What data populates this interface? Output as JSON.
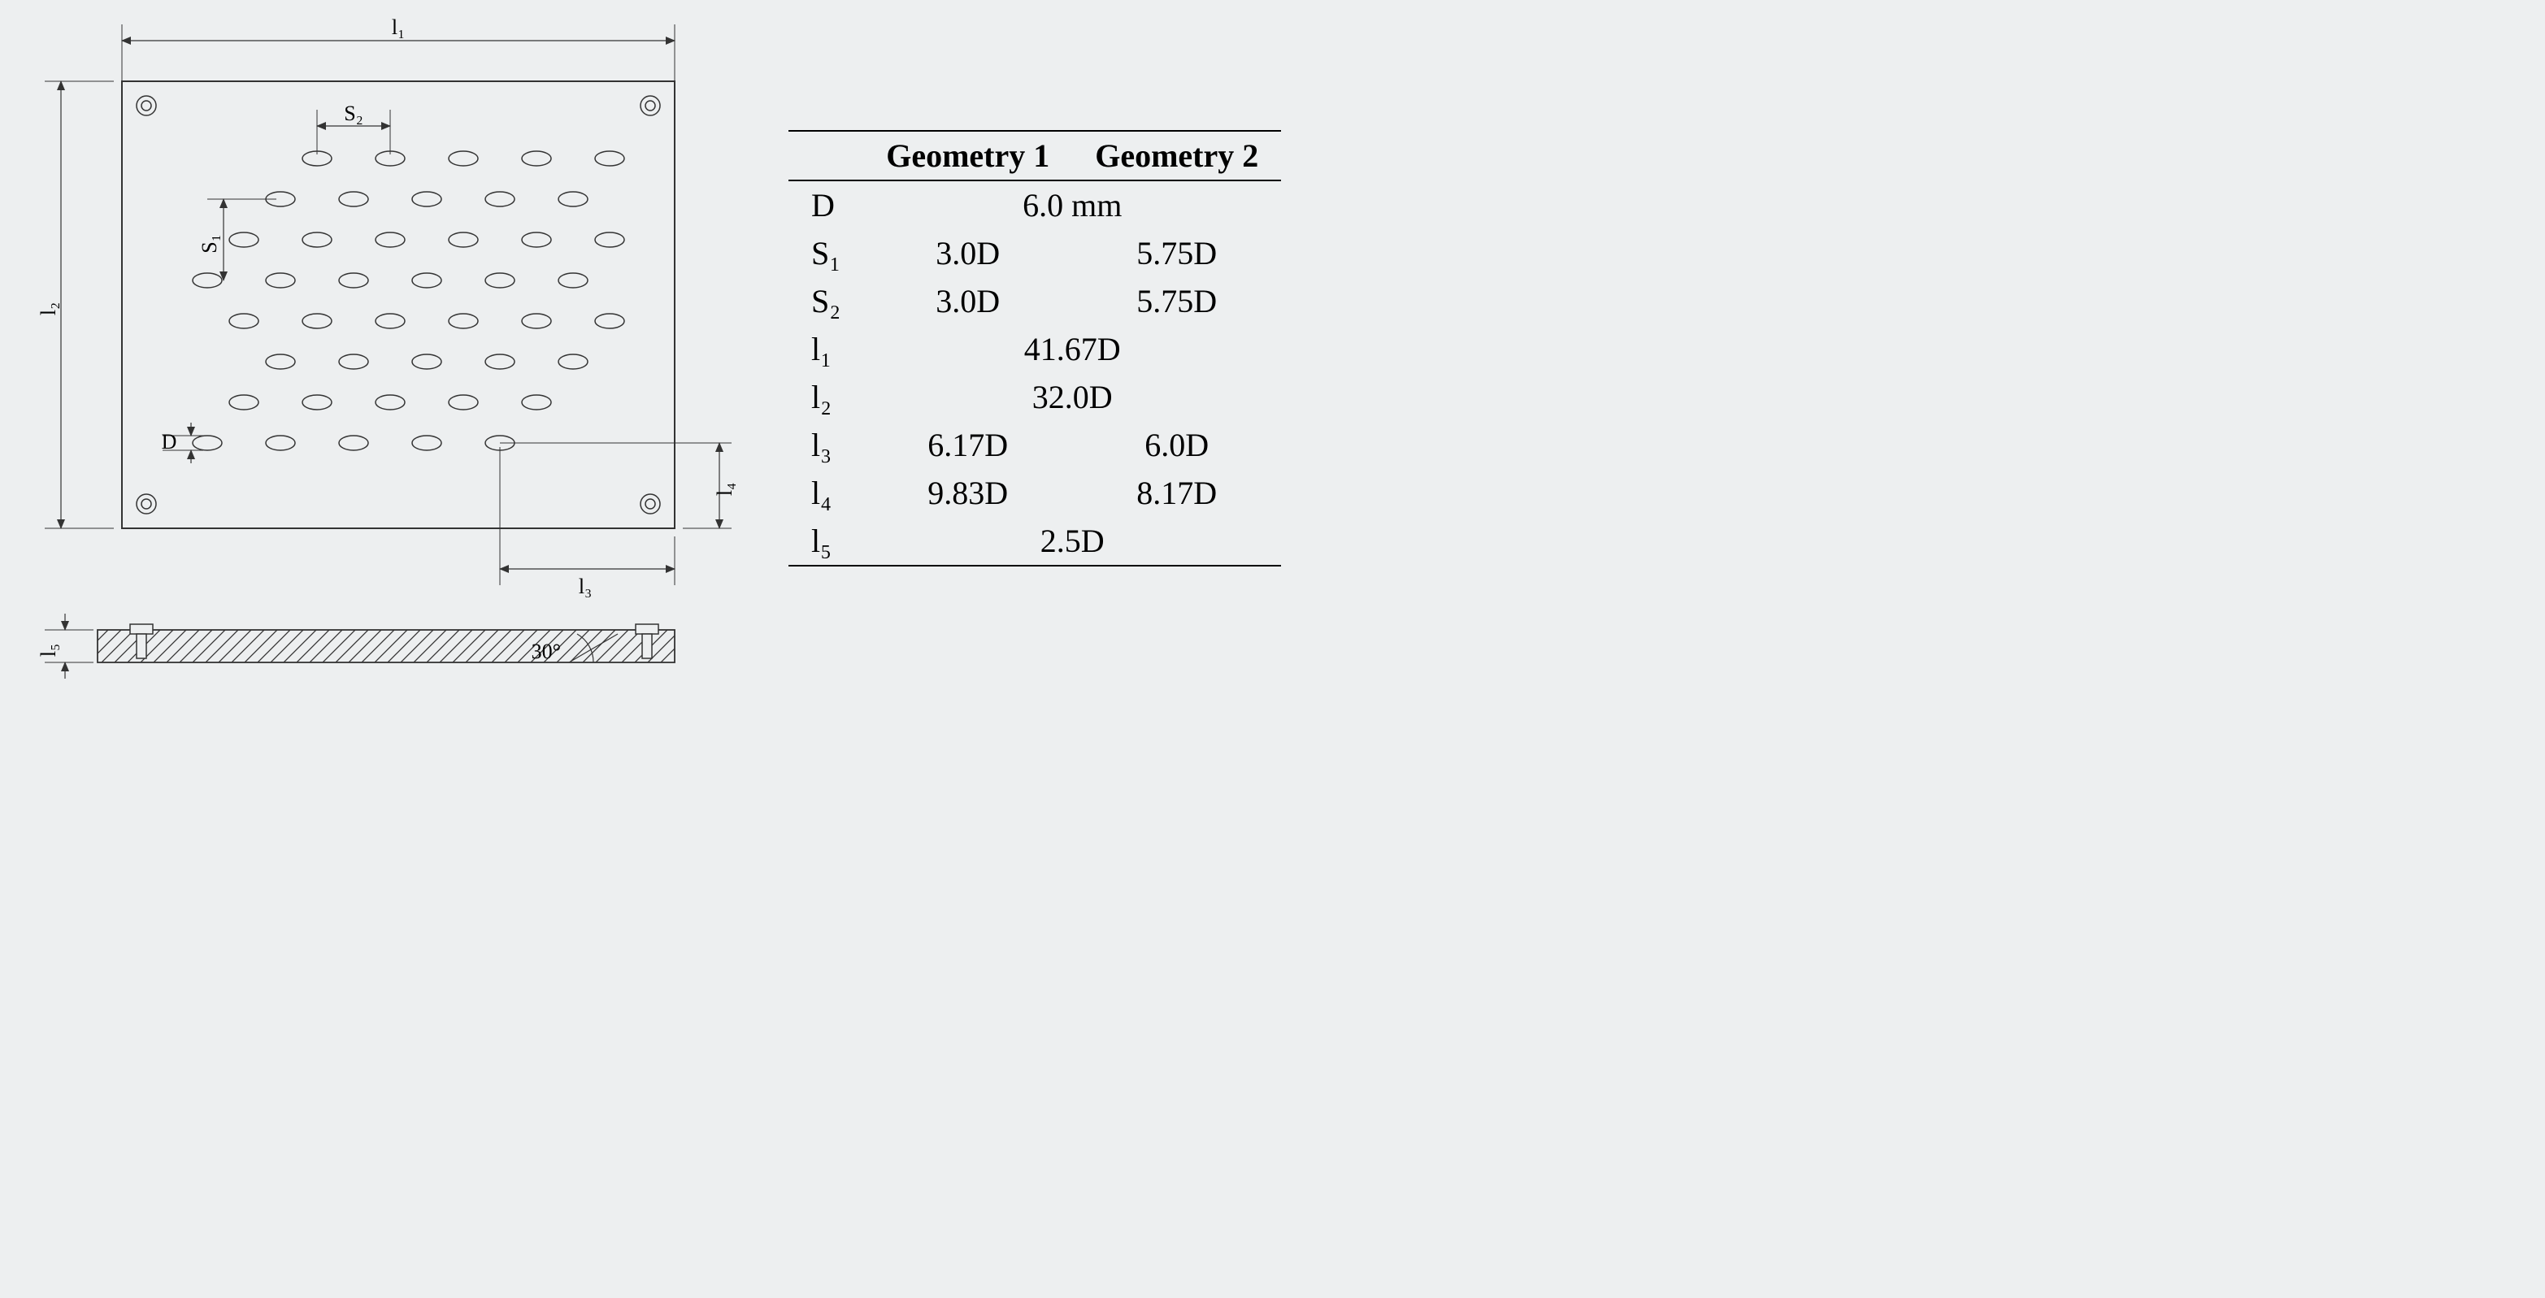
{
  "diagram": {
    "labels": {
      "l1": "l₁",
      "l2": "l₂",
      "l3": "l₃",
      "l4": "l₄",
      "l5": "l₅",
      "S1": "S₁",
      "S2": "S₂",
      "D": "D",
      "angle": "30°"
    }
  },
  "table": {
    "col1_header": "Geometry 1",
    "col2_header": "Geometry 2",
    "rows": [
      {
        "param": "D",
        "span": true,
        "val": "6.0 mm"
      },
      {
        "param": "S₁",
        "span": false,
        "v1": "3.0D",
        "v2": "5.75D"
      },
      {
        "param": "S₂",
        "span": false,
        "v1": "3.0D",
        "v2": "5.75D"
      },
      {
        "param": "l₁",
        "span": true,
        "val": "41.67D"
      },
      {
        "param": "l₂",
        "span": true,
        "val": "32.0D"
      },
      {
        "param": "l₃",
        "span": false,
        "v1": "6.17D",
        "v2": "6.0D"
      },
      {
        "param": "l₄",
        "span": false,
        "v1": "9.83D",
        "v2": "8.17D"
      },
      {
        "param": "l₅",
        "span": true,
        "val": "2.5D"
      }
    ]
  }
}
